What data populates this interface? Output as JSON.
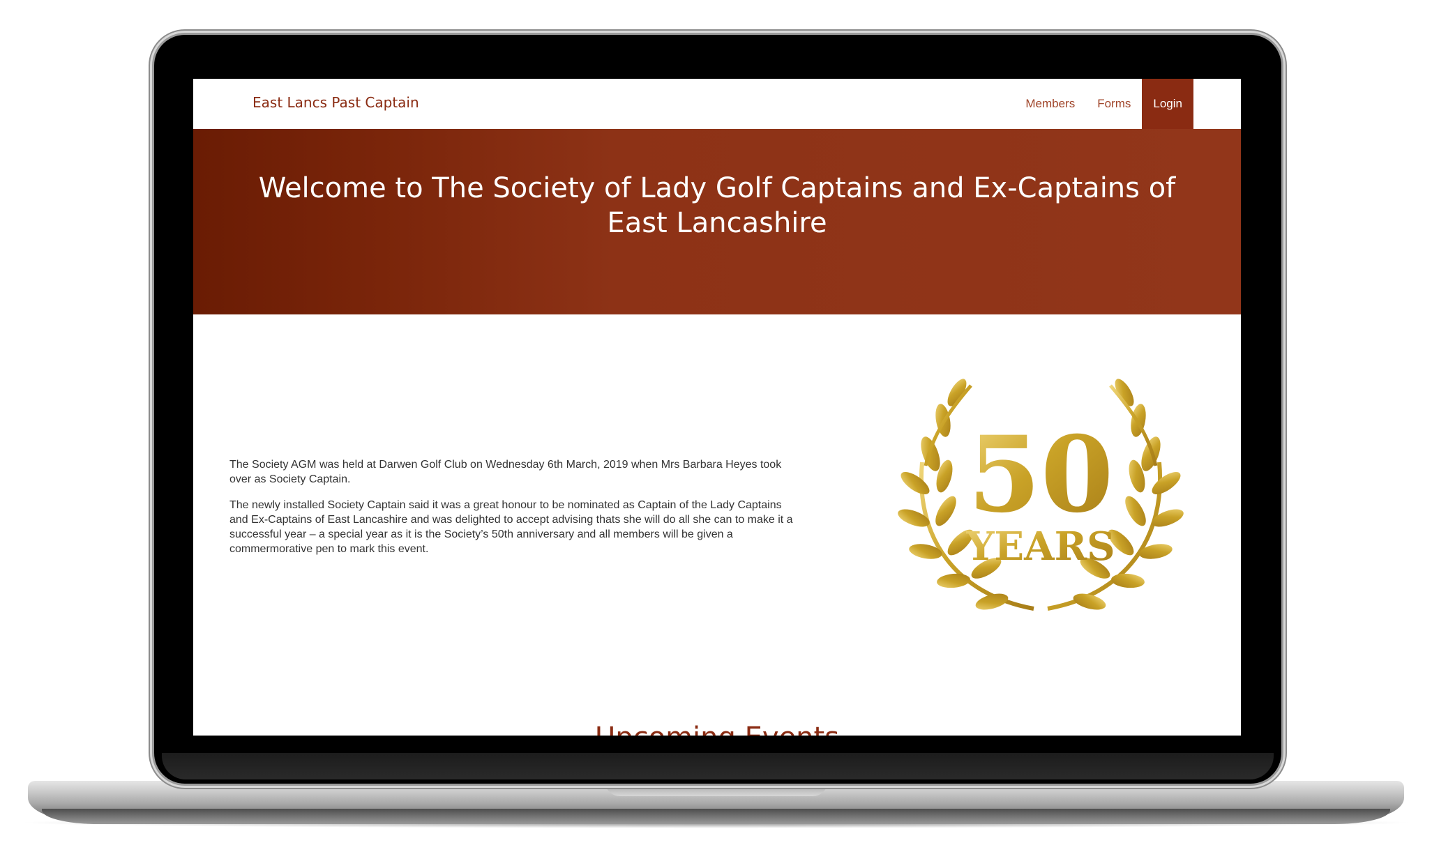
{
  "navbar": {
    "brand": "East Lancs Past Captain",
    "links": [
      {
        "label": "Members"
      },
      {
        "label": "Forms"
      },
      {
        "label": "Login"
      }
    ]
  },
  "hero": {
    "title": "Welcome to The Society of Lady Golf Captains and Ex-Captains of East Lancashire"
  },
  "content": {
    "paragraphs": [
      "The Society AGM was held at Darwen Golf Club on Wednesday 6th March, 2019 when Mrs Barbara Heyes took over as Society Captain.",
      "The newly installed Society Captain said it was a great honour to be nominated as Captain of the Lady Captains and Ex-Captains of East Lancashire and was delighted to accept advising thats she will do all she can to make it a successful year – a special year as it is the Society’s 50th anniversary and all members will be given a commermorative pen to mark this event."
    ],
    "badge": {
      "number": "50",
      "word": "YEARS"
    }
  },
  "events": {
    "heading": "Upcoming Events"
  },
  "colors": {
    "brand": "#8a2b12",
    "hero_start": "#6a1c04",
    "hero_end": "#92361a",
    "gold": "#c9a227"
  }
}
